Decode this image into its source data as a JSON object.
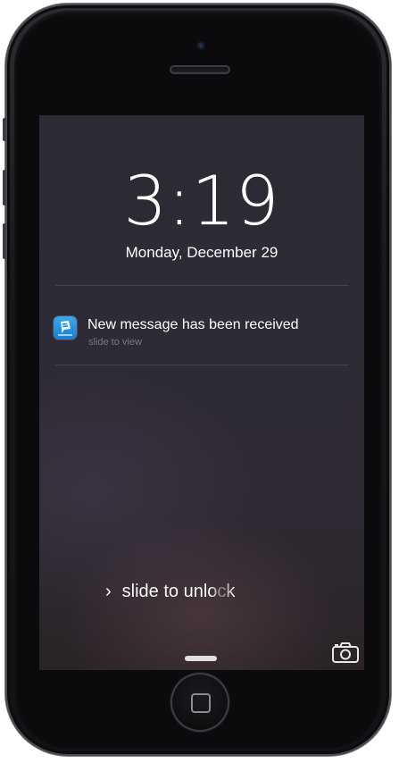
{
  "lockscreen": {
    "time": "3:19",
    "date": "Monday, December 29"
  },
  "notification": {
    "app_icon": "chat-app-icon",
    "title": "New message has been received",
    "subtitle": "slide to view"
  },
  "unlock": {
    "chevron": "›",
    "label": "slide to unlock"
  },
  "icons": {
    "camera": "camera-icon",
    "home": "home-button-icon"
  },
  "colors": {
    "app_icon_blue": "#2a93e0",
    "text": "#ffffff"
  }
}
